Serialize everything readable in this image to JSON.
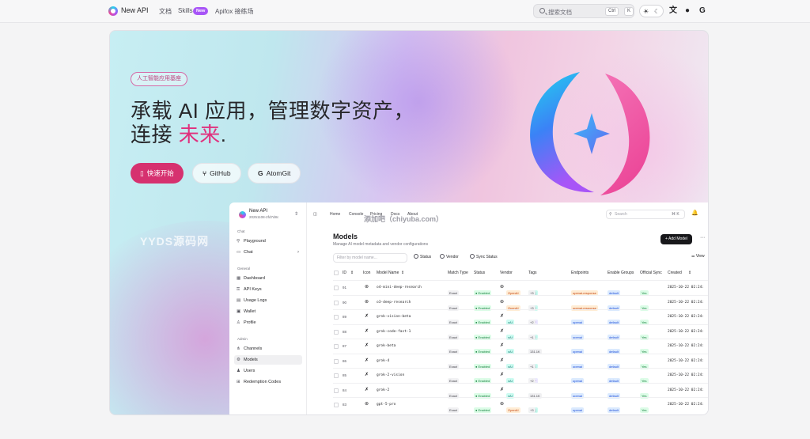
{
  "nav": {
    "brand": "New API",
    "links": [
      "文档",
      "Skills",
      "Apifox 接练场"
    ],
    "new_badge": "New",
    "search_placeholder": "搜索文档",
    "kbd": [
      "Ctrl",
      "K"
    ]
  },
  "hero": {
    "pill": "人工智能应用基座",
    "headline_line1": "承载 AI 应用，管理数字资产，",
    "headline_line2_prefix": "连接 ",
    "headline_accent": "未来",
    "headline_suffix": ".",
    "buttons": [
      "快速开始",
      "GitHub",
      "AtomGit"
    ],
    "watermark": "YYDS源码网",
    "overlay_text": "添加吧（chiyuba.com）"
  },
  "dashboard": {
    "app_name": "New API",
    "version": "20251108-2fd7d8c",
    "sidebar_groups": [
      {
        "label": "Chat",
        "items": [
          {
            "icon": "playground-icon",
            "label": "Playground"
          },
          {
            "icon": "chat-icon",
            "label": "Chat"
          }
        ]
      },
      {
        "label": "General",
        "items": [
          {
            "icon": "dashboard-icon",
            "label": "Dashboard"
          },
          {
            "icon": "key-icon",
            "label": "API Keys"
          },
          {
            "icon": "logs-icon",
            "label": "Usage Logs"
          },
          {
            "icon": "wallet-icon",
            "label": "Wallet"
          },
          {
            "icon": "profile-icon",
            "label": "Profile"
          }
        ]
      },
      {
        "label": "Admin",
        "items": [
          {
            "icon": "channels-icon",
            "label": "Channels"
          },
          {
            "icon": "models-icon",
            "label": "Models"
          },
          {
            "icon": "users-icon",
            "label": "Users"
          },
          {
            "icon": "redemption-icon",
            "label": "Redemption Codes"
          }
        ]
      }
    ],
    "active_item": "Models",
    "breadcrumbs": [
      "Home",
      "Console",
      "Pricing",
      "Docs",
      "About"
    ],
    "search_placeholder": "Search",
    "search_kbd": "⌘ K",
    "page_title": "Models",
    "page_subtitle": "Manage AI model metadata and vendor configurations",
    "add_button": "+ Add Model",
    "filter_placeholder": "Filter by model name...",
    "filters": [
      "Status",
      "Vendor",
      "Sync Status"
    ],
    "view_label": "View",
    "columns": [
      "ID",
      "Icon",
      "Model Name",
      "Match Type",
      "Status",
      "Vendor",
      "Tags",
      "Endpoints",
      "Enable Groups",
      "Official Sync",
      "Created"
    ],
    "rows": [
      {
        "id": "91",
        "icon": "openai-icon",
        "name": "o4-mini-deep-research",
        "match": "Exact",
        "status": "● Enabled",
        "vendor": "OpenAI",
        "tags": [
          "推理",
          "工具",
          "+3"
        ],
        "endpoint": "openai-response",
        "group": "default",
        "sync": "Yes",
        "created": "2025-10-22 02:24:"
      },
      {
        "id": "90",
        "icon": "openai-icon",
        "name": "o3-deep-research",
        "match": "Exact",
        "status": "● Enabled",
        "vendor": "OpenAI",
        "tags": [
          "推理",
          "工具",
          "+3"
        ],
        "endpoint": "openai-response",
        "group": "default",
        "sync": "Yes",
        "created": "2025-10-22 02:24:"
      },
      {
        "id": "89",
        "icon": "xai-icon",
        "name": "grok-vision-beta",
        "match": "Exact",
        "status": "● Enabled",
        "vendor": "xAI",
        "tags": [
          "工具",
          "文件",
          "+2"
        ],
        "endpoint": "openai",
        "group": "default",
        "sync": "Yes",
        "created": "2025-10-22 02:24:"
      },
      {
        "id": "88",
        "icon": "xai-icon",
        "name": "grok-code-fast-1",
        "match": "Exact",
        "status": "● Enabled",
        "vendor": "xAI",
        "tags": [
          "推理",
          "工具",
          "+1"
        ],
        "endpoint": "openai",
        "group": "default",
        "sync": "Yes",
        "created": "2025-10-22 02:24:"
      },
      {
        "id": "87",
        "icon": "xai-icon",
        "name": "grok-beta",
        "match": "Exact",
        "status": "● Enabled",
        "vendor": "xAI",
        "tags": [
          "工具",
          "131.1K"
        ],
        "endpoint": "openai",
        "group": "default",
        "sync": "Yes",
        "created": "2025-10-22 02:24:"
      },
      {
        "id": "86",
        "icon": "xai-icon",
        "name": "grok-4",
        "match": "Exact",
        "status": "● Enabled",
        "vendor": "xAI",
        "tags": [
          "推理",
          "工具",
          "+1"
        ],
        "endpoint": "openai",
        "group": "default",
        "sync": "Yes",
        "created": "2025-10-22 02:24:"
      },
      {
        "id": "85",
        "icon": "xai-icon",
        "name": "grok-2-vision",
        "match": "Exact",
        "status": "● Enabled",
        "vendor": "xAI",
        "tags": [
          "工具",
          "文件",
          "+2"
        ],
        "endpoint": "openai",
        "group": "default",
        "sync": "Yes",
        "created": "2025-10-22 02:24:"
      },
      {
        "id": "84",
        "icon": "xai-icon",
        "name": "grok-2",
        "match": "Exact",
        "status": "● Enabled",
        "vendor": "xAI",
        "tags": [
          "工具",
          "131.1K"
        ],
        "endpoint": "openai",
        "group": "default",
        "sync": "Yes",
        "created": "2025-10-22 02:24:"
      },
      {
        "id": "83",
        "icon": "openai-icon",
        "name": "gpt-5-pro",
        "match": "Exact",
        "status": "● Enabled",
        "vendor": "OpenAI",
        "tags": [
          "推理",
          "工具",
          "+3"
        ],
        "endpoint": "openai",
        "group": "default",
        "sync": "Yes",
        "created": "2025-10-22 02:24:"
      }
    ]
  },
  "colors": {
    "accent": "#e0307d",
    "primary_button": "#d6316f"
  }
}
